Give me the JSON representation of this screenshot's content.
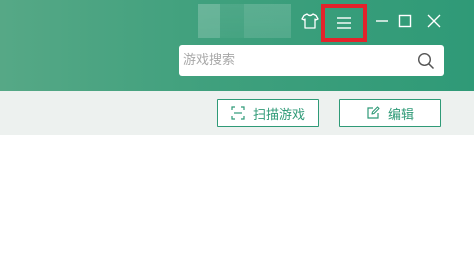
{
  "titlebar": {
    "accent": "#2f9a77",
    "highlight": "#e3232b",
    "icons": [
      "shirt-icon",
      "menu-icon",
      "minimize-icon",
      "maximize-icon",
      "close-icon"
    ]
  },
  "search": {
    "placeholder": "游戏搜索",
    "value": ""
  },
  "toolbar": {
    "scan_label": "扫描游戏",
    "edit_label": "编辑"
  }
}
